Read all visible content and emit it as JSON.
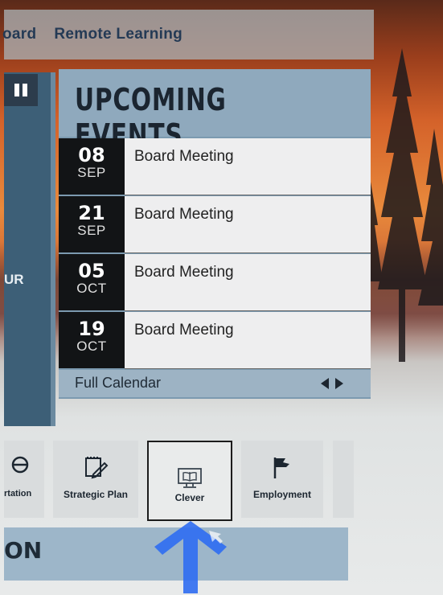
{
  "topnav": {
    "items": [
      "oard",
      "Remote Learning"
    ]
  },
  "left_panel": {
    "partial_text": "UR"
  },
  "events": {
    "title": "UPCOMING EVENTS",
    "items": [
      {
        "day": "08",
        "month": "SEP",
        "name": "Board Meeting"
      },
      {
        "day": "21",
        "month": "SEP",
        "name": "Board Meeting"
      },
      {
        "day": "05",
        "month": "OCT",
        "name": "Board Meeting"
      },
      {
        "day": "19",
        "month": "OCT",
        "name": "Board Meeting"
      }
    ],
    "footer_link": "Full Calendar"
  },
  "quick_links": [
    {
      "label": "rtation",
      "icon": "circle-slash-icon"
    },
    {
      "label": "Strategic Plan",
      "icon": "notepad-pencil-icon"
    },
    {
      "label": "Clever",
      "icon": "computer-book-icon",
      "selected": true
    },
    {
      "label": "Employment",
      "icon": "flag-icon"
    }
  ],
  "bottom_bar": {
    "partial_text": "ON"
  },
  "colors": {
    "accent_dark": "#1b2530",
    "panel_blue": "#7c9ab0",
    "pointer_blue": "#2f6df2"
  }
}
